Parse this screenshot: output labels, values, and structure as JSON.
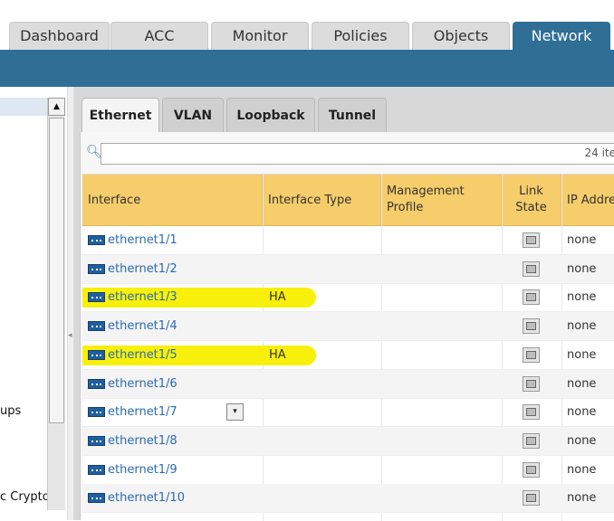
{
  "top_tabs": [
    "Dashboard",
    "ACC",
    "Monitor",
    "Policies",
    "Objects",
    "Network"
  ],
  "active_top_tab": "Network",
  "left_panel": {
    "partial_items": [
      "ups",
      "c Crypto"
    ]
  },
  "sub_tabs": [
    "Ethernet",
    "VLAN",
    "Loopback",
    "Tunnel"
  ],
  "active_sub_tab": "Ethernet",
  "search": {
    "value": "",
    "count_text": "24 ite"
  },
  "table": {
    "columns": [
      "Interface",
      "Interface Type",
      "Management Profile",
      "Link State",
      "IP Address"
    ],
    "column_display": {
      "mgmt_line1": "Management",
      "mgmt_line2": "Profile",
      "link_line1": "Link",
      "link_line2": "State",
      "ip_visible": "IP Addre"
    },
    "rows": [
      {
        "interface": "ethernet1/1",
        "type": "",
        "ip": "none",
        "highlighted": false
      },
      {
        "interface": "ethernet1/2",
        "type": "",
        "ip": "none",
        "highlighted": false
      },
      {
        "interface": "ethernet1/3",
        "type": "HA",
        "ip": "none",
        "highlighted": true
      },
      {
        "interface": "ethernet1/4",
        "type": "",
        "ip": "none",
        "highlighted": false
      },
      {
        "interface": "ethernet1/5",
        "type": "HA",
        "ip": "none",
        "highlighted": true
      },
      {
        "interface": "ethernet1/6",
        "type": "",
        "ip": "none",
        "highlighted": false
      },
      {
        "interface": "ethernet1/7",
        "type": "",
        "ip": "none",
        "highlighted": false,
        "has_dropdown": true
      },
      {
        "interface": "ethernet1/8",
        "type": "",
        "ip": "none",
        "highlighted": false
      },
      {
        "interface": "ethernet1/9",
        "type": "",
        "ip": "none",
        "highlighted": false
      },
      {
        "interface": "ethernet1/10",
        "type": "",
        "ip": "none",
        "highlighted": false
      }
    ]
  },
  "colors": {
    "nav_blue": "#2f6f96",
    "header_yellow": "#f6cd6b",
    "highlight_yellow": "#f8f00a",
    "link_blue": "#2a6bb0"
  }
}
